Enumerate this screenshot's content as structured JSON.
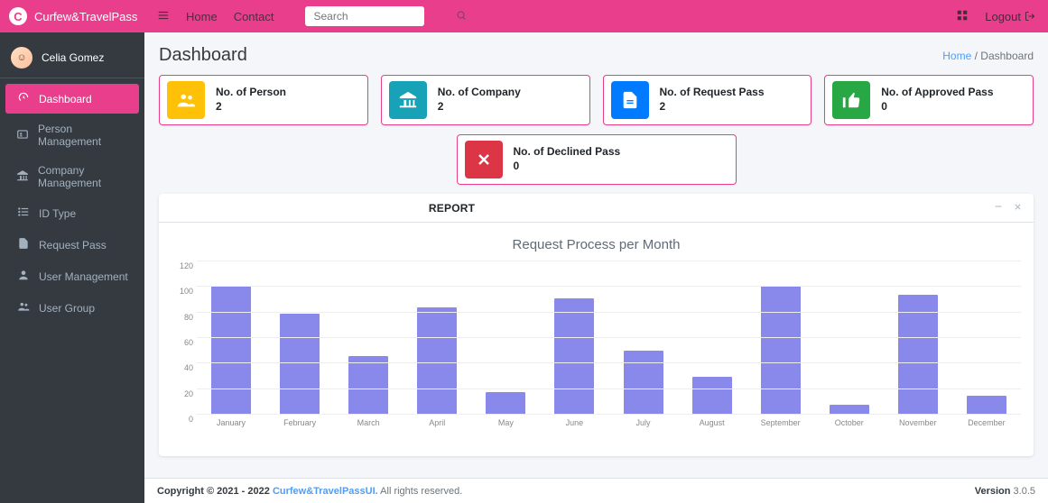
{
  "brand": {
    "logo_letter": "C",
    "name": "Curfew&TravelPass"
  },
  "nav": {
    "home": "Home",
    "contact": "Contact",
    "search_placeholder": "Search",
    "logout": "Logout"
  },
  "user": {
    "name": "Celia Gomez"
  },
  "sidebar": {
    "items": [
      {
        "label": "Dashboard",
        "icon": "speedometer",
        "active": true
      },
      {
        "label": "Person Management",
        "icon": "id-card"
      },
      {
        "label": "Company Management",
        "icon": "bank"
      },
      {
        "label": "ID Type",
        "icon": "list"
      },
      {
        "label": "Request Pass",
        "icon": "file"
      },
      {
        "label": "User Management",
        "icon": "user"
      },
      {
        "label": "User Group",
        "icon": "users"
      }
    ]
  },
  "page": {
    "title": "Dashboard"
  },
  "breadcrumb": {
    "home": "Home",
    "sep": "/",
    "current": "Dashboard"
  },
  "infoboxes": [
    {
      "label": "No. of Person",
      "value": "2",
      "color": "bg-yellow",
      "icon": "users"
    },
    {
      "label": "No. of Company",
      "value": "2",
      "color": "bg-teal",
      "icon": "bank"
    },
    {
      "label": "No. of Request Pass",
      "value": "2",
      "color": "bg-blue",
      "icon": "file"
    },
    {
      "label": "No. of Approved Pass",
      "value": "0",
      "color": "bg-green",
      "icon": "thumbs-up"
    }
  ],
  "infobox_declined": {
    "label": "No. of Declined Pass",
    "value": "0",
    "color": "bg-red",
    "icon": "close"
  },
  "card": {
    "title": "REPORT",
    "chart_title": "Request Process per Month"
  },
  "chart_data": {
    "type": "bar",
    "title": "Request Process per Month",
    "xlabel": "",
    "ylabel": "",
    "ylim": [
      0,
      120
    ],
    "y_ticks": [
      0,
      20,
      40,
      60,
      80,
      100,
      120
    ],
    "categories": [
      "January",
      "February",
      "March",
      "April",
      "May",
      "June",
      "July",
      "August",
      "September",
      "October",
      "November",
      "December"
    ],
    "values": [
      101,
      79,
      46,
      84,
      18,
      91,
      50,
      30,
      101,
      8,
      94,
      15
    ]
  },
  "footer": {
    "copyright_strong": "Copyright © 2021 - 2022",
    "link": "Curfew&TravelPassUI.",
    "rest": " All rights reserved.",
    "version_label": "Version",
    "version": "3.0.5"
  }
}
